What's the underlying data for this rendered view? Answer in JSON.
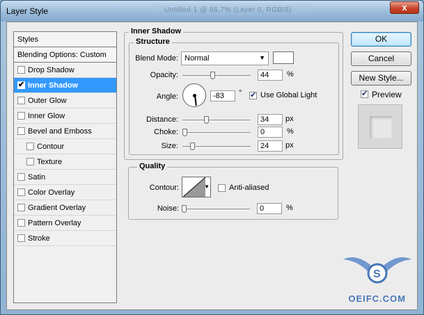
{
  "window": {
    "title": "Layer Style",
    "background_tab_text": "Untitled-1 @ 66.7% (Layer 0, RGB/8)",
    "close_label": "x"
  },
  "styles_list": {
    "header": "Styles",
    "blending": "Blending Options: Custom",
    "items": [
      {
        "label": "Drop Shadow",
        "checked": false,
        "selected": false,
        "sub": false
      },
      {
        "label": "Inner Shadow",
        "checked": true,
        "selected": true,
        "sub": false
      },
      {
        "label": "Outer Glow",
        "checked": false,
        "selected": false,
        "sub": false
      },
      {
        "label": "Inner Glow",
        "checked": false,
        "selected": false,
        "sub": false
      },
      {
        "label": "Bevel and Emboss",
        "checked": false,
        "selected": false,
        "sub": false
      },
      {
        "label": "Contour",
        "checked": false,
        "selected": false,
        "sub": true
      },
      {
        "label": "Texture",
        "checked": false,
        "selected": false,
        "sub": true
      },
      {
        "label": "Satin",
        "checked": false,
        "selected": false,
        "sub": false
      },
      {
        "label": "Color Overlay",
        "checked": false,
        "selected": false,
        "sub": false
      },
      {
        "label": "Gradient Overlay",
        "checked": false,
        "selected": false,
        "sub": false
      },
      {
        "label": "Pattern Overlay",
        "checked": false,
        "selected": false,
        "sub": false
      },
      {
        "label": "Stroke",
        "checked": false,
        "selected": false,
        "sub": false
      }
    ]
  },
  "inner_shadow": {
    "title": "Inner Shadow",
    "structure": {
      "title": "Structure",
      "blend_mode_label": "Blend Mode:",
      "blend_mode_value": "Normal",
      "blend_color": "#ffffff",
      "opacity_label": "Opacity:",
      "opacity_value": "44",
      "opacity_fraction": 0.44,
      "angle_label": "Angle:",
      "angle_value": "-83",
      "angle_unit": "°",
      "use_global_light_label": "Use Global Light",
      "use_global_light_checked": true,
      "distance_label": "Distance:",
      "distance_value": "34",
      "distance_fraction": 0.34,
      "choke_label": "Choke:",
      "choke_value": "0",
      "choke_fraction": 0,
      "size_label": "Size:",
      "size_value": "24",
      "size_fraction": 0.12,
      "unit_px": "px",
      "unit_pct": "%"
    },
    "quality": {
      "title": "Quality",
      "contour_label": "Contour:",
      "anti_aliased_label": "Anti-aliased",
      "anti_aliased_checked": false,
      "noise_label": "Noise:",
      "noise_value": "0",
      "noise_fraction": 0,
      "unit_pct": "%"
    }
  },
  "buttons": {
    "ok": "OK",
    "cancel": "Cancel",
    "new_style": "New Style...",
    "preview_label": "Preview",
    "preview_checked": true
  },
  "watermark": {
    "text": "OEIFC.COM"
  },
  "colors": {
    "selection": "#3399ff",
    "titlebar": "#9ebedb"
  }
}
